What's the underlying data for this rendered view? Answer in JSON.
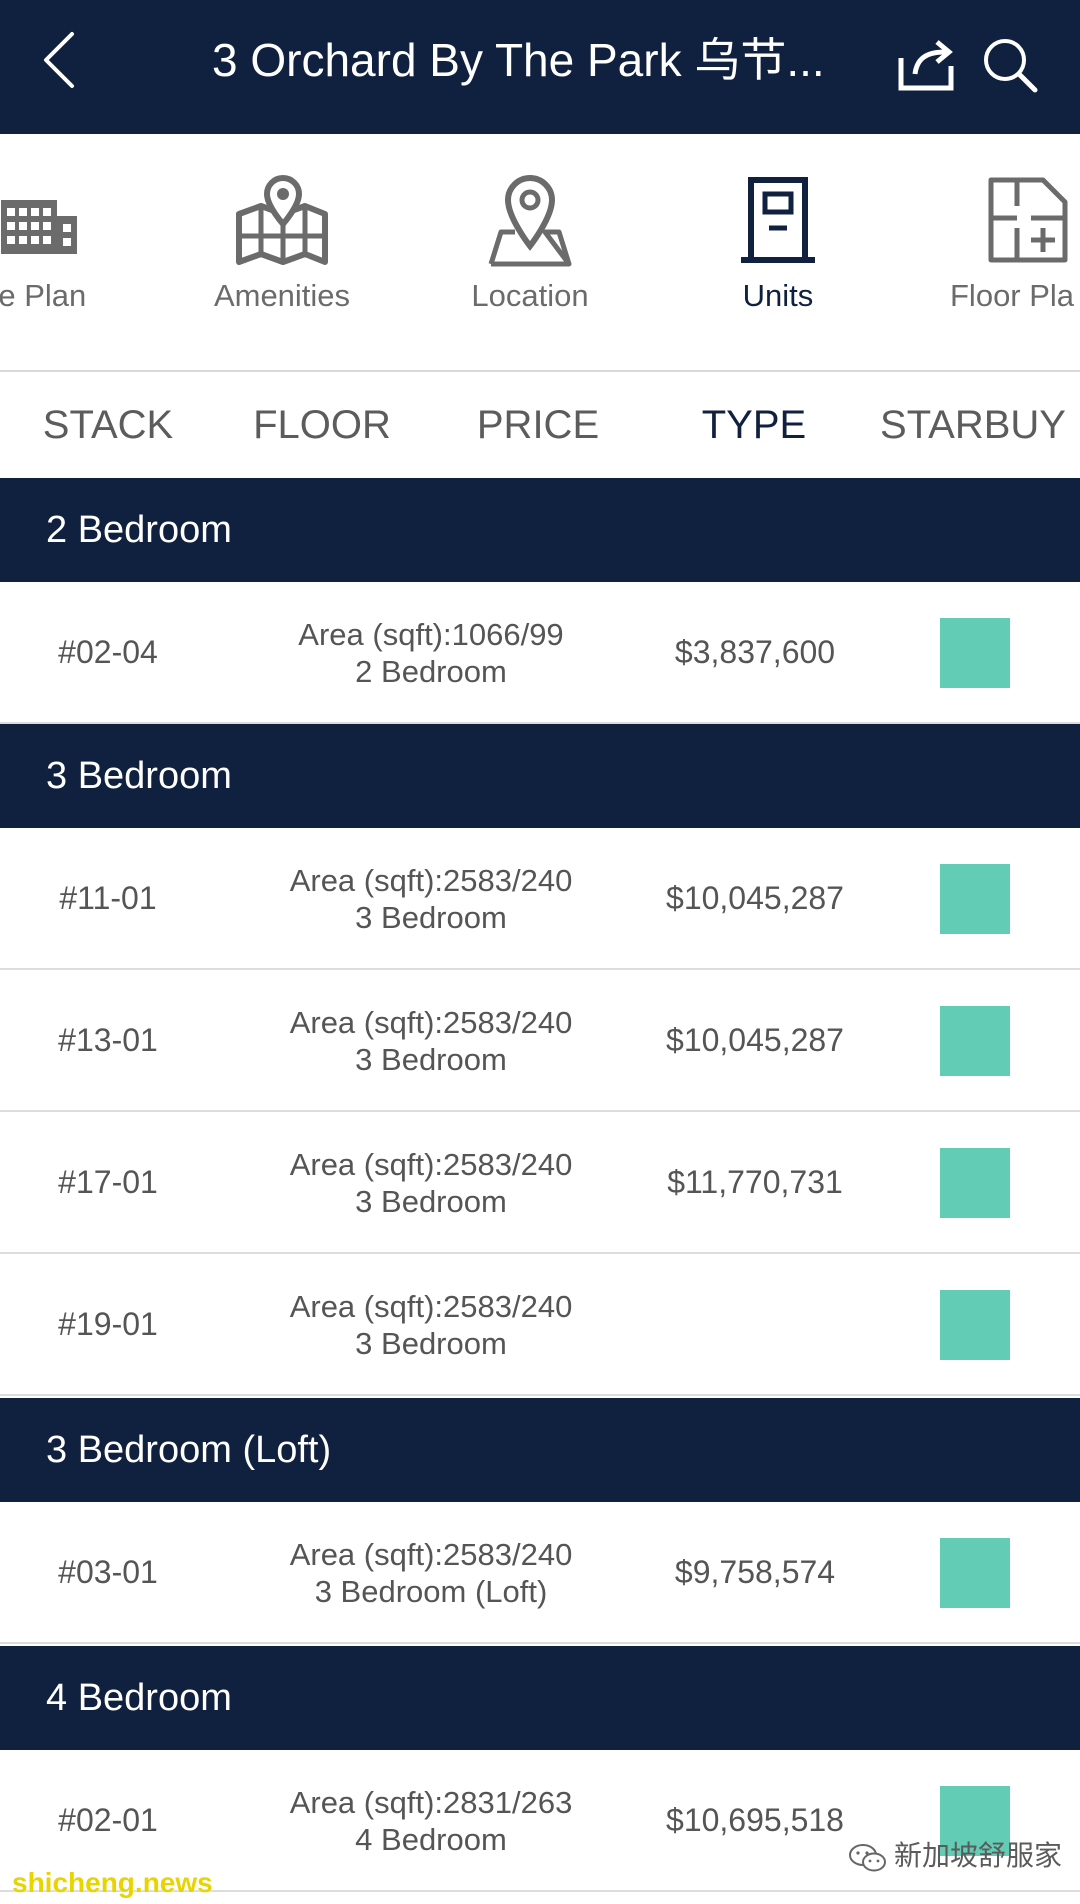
{
  "header": {
    "title": "3 Orchard By The Park 乌节..."
  },
  "nav": {
    "items": [
      {
        "label": "te Plan",
        "icon": "building-icon",
        "active": false
      },
      {
        "label": "Amenities",
        "icon": "map-pin-icon",
        "active": false
      },
      {
        "label": "Location",
        "icon": "location-pin-icon",
        "active": false
      },
      {
        "label": "Units",
        "icon": "door-icon",
        "active": true
      },
      {
        "label": "Floor Pla",
        "icon": "floor-plan-icon",
        "active": false
      }
    ]
  },
  "sort": {
    "columns": [
      "STACK",
      "FLOOR",
      "PRICE",
      "TYPE",
      "STARBUY"
    ],
    "active": "TYPE"
  },
  "groups": [
    {
      "name": "2 Bedroom",
      "units": [
        {
          "stack": "#02-04",
          "area": "Area (sqft):1066/99",
          "type": "2 Bedroom",
          "price": "$3,837,600"
        }
      ]
    },
    {
      "name": "3 Bedroom",
      "units": [
        {
          "stack": "#11-01",
          "area": "Area (sqft):2583/240",
          "type": "3 Bedroom",
          "price": "$10,045,287"
        },
        {
          "stack": "#13-01",
          "area": "Area (sqft):2583/240",
          "type": "3 Bedroom",
          "price": "$10,045,287"
        },
        {
          "stack": "#17-01",
          "area": "Area (sqft):2583/240",
          "type": "3 Bedroom",
          "price": "$11,770,731"
        },
        {
          "stack": "#19-01",
          "area": "Area (sqft):2583/240",
          "type": "3 Bedroom",
          "price": ""
        }
      ]
    },
    {
      "name": "3 Bedroom (Loft)",
      "units": [
        {
          "stack": "#03-01",
          "area": "Area (sqft):2583/240",
          "type": "3 Bedroom (Loft)",
          "price": "$9,758,574"
        }
      ]
    },
    {
      "name": "4 Bedroom",
      "units": [
        {
          "stack": "#02-01",
          "area": "Area (sqft):2831/263",
          "type": "4 Bedroom",
          "price": "$10,695,518"
        }
      ]
    }
  ],
  "colors": {
    "navy": "#10203f",
    "starbuy": "#62cdb4"
  },
  "watermarks": {
    "wechat": "新加坡舒服家",
    "site": "shicheng.news"
  }
}
